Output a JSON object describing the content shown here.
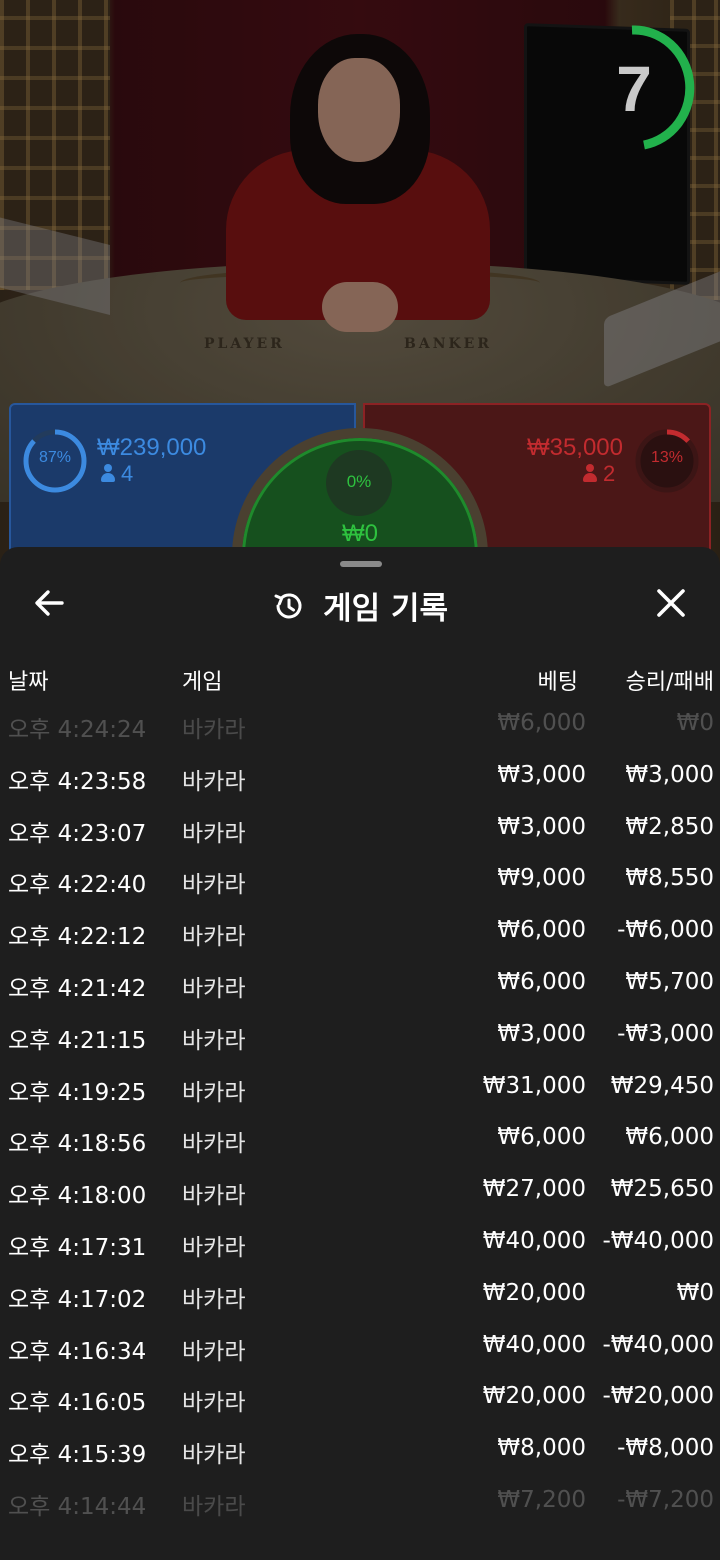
{
  "video": {
    "timer": "7",
    "table_labels": {
      "player": "PLAYER",
      "banker": "BANKER"
    }
  },
  "bets": {
    "player": {
      "percent": "87%",
      "amount": "₩239,000",
      "count": "4"
    },
    "banker": {
      "percent": "13%",
      "amount": "₩35,000",
      "count": "2"
    },
    "tie": {
      "percent": "0%",
      "amount": "₩0"
    }
  },
  "colors": {
    "player": "#3c8ae0",
    "banker": "#c22b2f",
    "tie": "#2ec23f",
    "timer_ring": "#22b14c",
    "sheet_bg": "#1e1e1e"
  },
  "history": {
    "title": "게임 기록",
    "icons": {
      "back": "arrow-left-icon",
      "history": "history-icon",
      "close": "close-icon"
    },
    "columns": {
      "date": "날짜",
      "game": "게임",
      "bet": "베팅",
      "result": "승리/패배"
    },
    "rows": [
      {
        "time": "오후 4:24:24",
        "game": "바카라",
        "bet": "₩6,000",
        "result": "₩0"
      },
      {
        "time": "오후 4:23:58",
        "game": "바카라",
        "bet": "₩3,000",
        "result": "₩3,000"
      },
      {
        "time": "오후 4:23:07",
        "game": "바카라",
        "bet": "₩3,000",
        "result": "₩2,850"
      },
      {
        "time": "오후 4:22:40",
        "game": "바카라",
        "bet": "₩9,000",
        "result": "₩8,550"
      },
      {
        "time": "오후 4:22:12",
        "game": "바카라",
        "bet": "₩6,000",
        "result": "-₩6,000"
      },
      {
        "time": "오후 4:21:42",
        "game": "바카라",
        "bet": "₩6,000",
        "result": "₩5,700"
      },
      {
        "time": "오후 4:21:15",
        "game": "바카라",
        "bet": "₩3,000",
        "result": "-₩3,000"
      },
      {
        "time": "오후 4:19:25",
        "game": "바카라",
        "bet": "₩31,000",
        "result": "₩29,450"
      },
      {
        "time": "오후 4:18:56",
        "game": "바카라",
        "bet": "₩6,000",
        "result": "₩6,000"
      },
      {
        "time": "오후 4:18:00",
        "game": "바카라",
        "bet": "₩27,000",
        "result": "₩25,650"
      },
      {
        "time": "오후 4:17:31",
        "game": "바카라",
        "bet": "₩40,000",
        "result": "-₩40,000"
      },
      {
        "time": "오후 4:17:02",
        "game": "바카라",
        "bet": "₩20,000",
        "result": "₩0"
      },
      {
        "time": "오후 4:16:34",
        "game": "바카라",
        "bet": "₩40,000",
        "result": "-₩40,000"
      },
      {
        "time": "오후 4:16:05",
        "game": "바카라",
        "bet": "₩20,000",
        "result": "-₩20,000"
      },
      {
        "time": "오후 4:15:39",
        "game": "바카라",
        "bet": "₩8,000",
        "result": "-₩8,000"
      },
      {
        "time": "오후 4:14:44",
        "game": "바카라",
        "bet": "₩7,200",
        "result": "-₩7,200"
      }
    ]
  }
}
